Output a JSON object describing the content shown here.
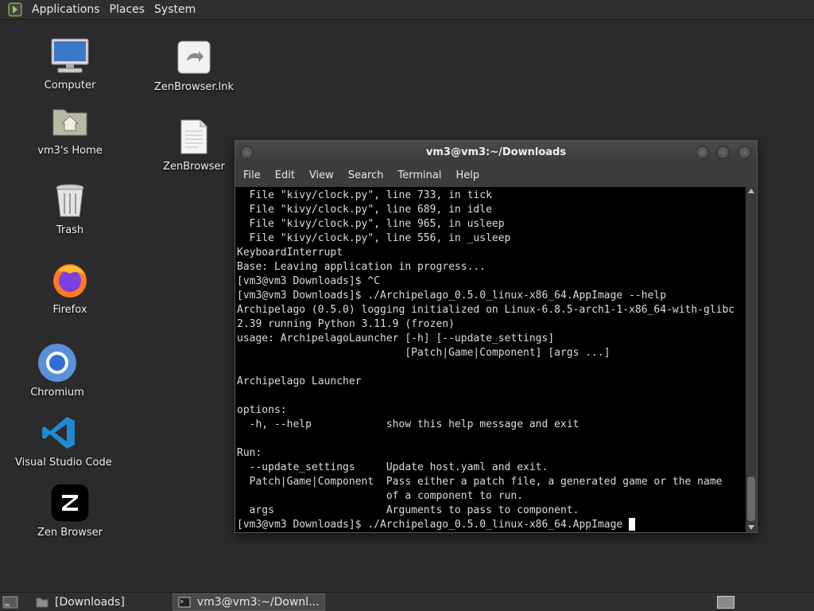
{
  "top_panel": {
    "menus": [
      "Applications",
      "Places",
      "System"
    ]
  },
  "desktop": {
    "icons": [
      {
        "label": "Computer",
        "icon": "computer-icon"
      },
      {
        "label": "vm3's Home",
        "icon": "home-folder-icon"
      },
      {
        "label": "Trash",
        "icon": "trash-icon"
      },
      {
        "label": "Firefox",
        "icon": "firefox-icon"
      },
      {
        "label": "Chromium",
        "icon": "chromium-icon"
      },
      {
        "label": "Visual Studio Code",
        "icon": "vscode-icon"
      },
      {
        "label": "Zen Browser",
        "icon": "zen-browser-icon"
      },
      {
        "label": "ZenBrowser.lnk",
        "icon": "shortcut-icon"
      },
      {
        "label": "ZenBrowser",
        "icon": "file-icon"
      }
    ]
  },
  "terminal": {
    "title": "vm3@vm3:~/Downloads",
    "menu": [
      "File",
      "Edit",
      "View",
      "Search",
      "Terminal",
      "Help"
    ],
    "lines": [
      "  File \"kivy/clock.py\", line 733, in tick",
      "  File \"kivy/clock.py\", line 689, in idle",
      "  File \"kivy/clock.py\", line 965, in usleep",
      "  File \"kivy/clock.py\", line 556, in _usleep",
      "KeyboardInterrupt",
      "Base: Leaving application in progress...",
      "[vm3@vm3 Downloads]$ ^C",
      "[vm3@vm3 Downloads]$ ./Archipelago_0.5.0_linux-x86_64.AppImage --help",
      "Archipelago (0.5.0) logging initialized on Linux-6.8.5-arch1-1-x86_64-with-glibc",
      "2.39 running Python 3.11.9 (frozen)",
      "usage: ArchipelagoLauncher [-h] [--update_settings]",
      "                           [Patch|Game|Component] [args ...]",
      "",
      "Archipelago Launcher",
      "",
      "options:",
      "  -h, --help            show this help message and exit",
      "",
      "Run:",
      "  --update_settings     Update host.yaml and exit.",
      "  Patch|Game|Component  Pass either a patch file, a generated game or the name",
      "                        of a component to run.",
      "  args                  Arguments to pass to component."
    ],
    "prompt": "[vm3@vm3 Downloads]$ ./Archipelago_0.5.0_linux-x86_64.AppImage "
  },
  "taskbar": {
    "tasks": [
      {
        "label": "[Downloads]",
        "icon": "folder-icon",
        "active": false
      },
      {
        "label": "vm3@vm3:~/Downl...",
        "icon": "terminal-icon",
        "active": true
      }
    ]
  }
}
